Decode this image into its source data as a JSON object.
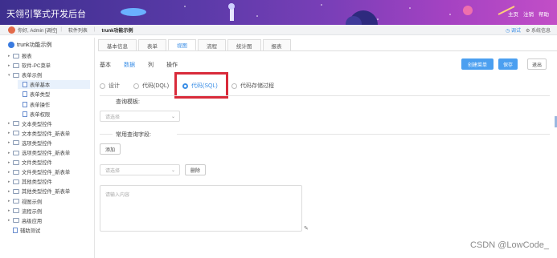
{
  "header": {
    "title": "天翎引擎式开发后台",
    "links": [
      "主页",
      "注销",
      "帮助"
    ]
  },
  "crumb": {
    "greeting": "你好, Admin [调控]",
    "tabs": [
      "软件列表",
      "trunk功能示例"
    ],
    "right": [
      "调试",
      "系统信息"
    ]
  },
  "sidebar": {
    "root": "trunk功能示例",
    "items": [
      {
        "label": "报表",
        "type": "folder"
      },
      {
        "label": "软件-PC菜单",
        "type": "folder"
      },
      {
        "label": "表单示例",
        "type": "folder",
        "open": true
      },
      {
        "label": "表单基本",
        "type": "doc",
        "selected": true
      },
      {
        "label": "表单类型",
        "type": "doc"
      },
      {
        "label": "表单操作",
        "type": "doc"
      },
      {
        "label": "表单权限",
        "type": "doc"
      },
      {
        "label": "文本类型控件",
        "type": "folder"
      },
      {
        "label": "文本类型控件_新表单",
        "type": "folder"
      },
      {
        "label": "选项类型控件",
        "type": "folder"
      },
      {
        "label": "选项类型控件_新表单",
        "type": "folder"
      },
      {
        "label": "文件类型控件",
        "type": "folder"
      },
      {
        "label": "文件类型控件_新表单",
        "type": "folder"
      },
      {
        "label": "其他类型控件",
        "type": "folder"
      },
      {
        "label": "其他类型控件_新表单",
        "type": "folder"
      },
      {
        "label": "视图示例",
        "type": "folder"
      },
      {
        "label": "流程示例",
        "type": "folder"
      },
      {
        "label": "高级应用",
        "type": "folder"
      },
      {
        "label": "辅助测试",
        "type": "doc"
      }
    ]
  },
  "content_tabs": [
    "基本信息",
    "表单",
    "视图",
    "流程",
    "统计图",
    "报表"
  ],
  "active_content_tab": 2,
  "sub_tabs": [
    "基本",
    "数据",
    "列",
    "操作"
  ],
  "active_sub_tab": 1,
  "buttons": {
    "create_menu": "创建菜单",
    "save": "保存",
    "exit": "退出"
  },
  "radios": [
    "设计",
    "代码(DQL)",
    "代码(SQL)",
    "代码存储过程"
  ],
  "active_radio": 2,
  "query_template_label": "查询模板:",
  "query_template_placeholder": "请选择",
  "common_fields_label": "常用查询字段:",
  "add_button": "添加",
  "field_select_placeholder": "请选择",
  "delete_button": "删除",
  "textarea_placeholder": "请输入内容",
  "watermark": "CSDN @LowCode_"
}
